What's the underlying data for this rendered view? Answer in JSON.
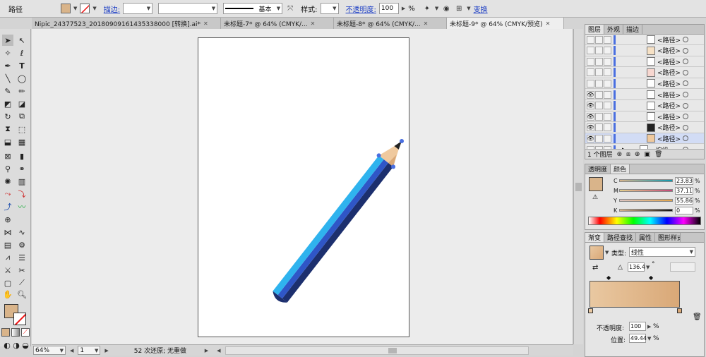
{
  "control_bar": {
    "object_type": "路径",
    "stroke_label": "描边:",
    "stroke_profile": "基本",
    "style_label": "样式:",
    "opacity_label": "不透明度:",
    "opacity_value": "100",
    "opacity_unit": "%",
    "transform_label": "变换"
  },
  "tabs": [
    {
      "label": "Nipic_24377523_20180909161435338000 [转换].ai*"
    },
    {
      "label": "未标题-7* @ 64% (CMYK/..."
    },
    {
      "label": "未标题-8* @ 64% (CMYK/..."
    },
    {
      "label": "未标题-9* @ 64% (CMYK/预览)"
    }
  ],
  "status_bar": {
    "zoom": "64%",
    "page": "1",
    "message": "52 次还原; 无重做"
  },
  "layers_panel": {
    "tabs": [
      "图层",
      "外观",
      "描边"
    ],
    "rows": [
      {
        "name": "<路径>",
        "visible": false
      },
      {
        "name": "<路径>",
        "visible": false
      },
      {
        "name": "<路径>",
        "visible": false
      },
      {
        "name": "<路径>",
        "visible": false
      },
      {
        "name": "<路径>",
        "visible": false
      },
      {
        "name": "<路径>",
        "visible": true
      },
      {
        "name": "<路径>",
        "visible": true
      },
      {
        "name": "<路径>",
        "visible": true
      },
      {
        "name": "<路径>",
        "visible": true
      },
      {
        "name": "<路径>",
        "visible": true
      },
      {
        "name": "<编组>",
        "visible": false
      }
    ],
    "footer_count": "1 个图层"
  },
  "color_panel": {
    "tabs": [
      "透明度",
      "颜色"
    ],
    "channels": [
      {
        "label": "C",
        "value": "23.83"
      },
      {
        "label": "M",
        "value": "37.11"
      },
      {
        "label": "Y",
        "value": "55.86"
      },
      {
        "label": "K",
        "value": "0"
      }
    ],
    "unit": "%"
  },
  "gradient_panel": {
    "tabs": [
      "渐变",
      "路径查找",
      "属性",
      "图形样式"
    ],
    "type_label": "类型:",
    "type_value": "线性",
    "angle_value": "136.4",
    "angle_unit": "°",
    "opacity_label": "不透明度:",
    "opacity_value": "100",
    "location_label": "位置:",
    "location_value": "49.44",
    "unit": "%"
  },
  "colors": {
    "fill_tan": "#d9b48a",
    "pencil_dark": "#1c2f6e",
    "pencil_mid": "#2f56c7",
    "pencil_light": "#2fb3ee",
    "pencil_wood": "#efc99e",
    "gradient_start": "#e9c8a1",
    "gradient_end": "#d9a877"
  }
}
